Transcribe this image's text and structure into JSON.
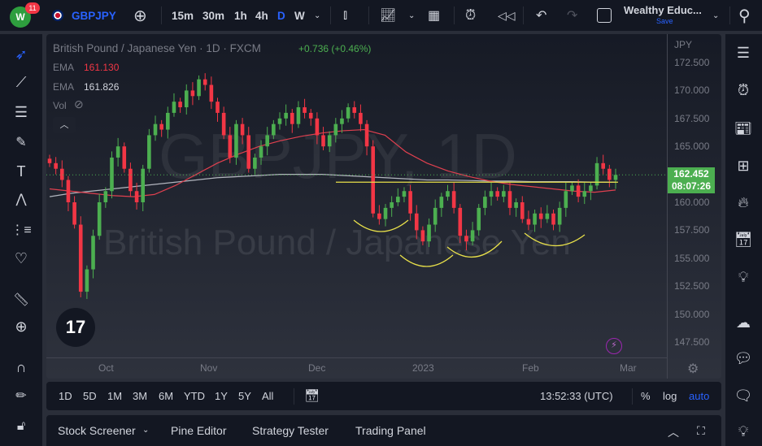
{
  "topbar": {
    "badge": "11",
    "symbol": "GBPJPY",
    "intervals": [
      "15m",
      "30m",
      "1h",
      "4h",
      "D",
      "W"
    ],
    "active_interval": "D",
    "layout_name": "Wealthy Educ...",
    "save_label": "Save"
  },
  "legend": {
    "title": "British Pound / Japanese Yen · 1D · FXCM",
    "change": "+0.736 (+0.46%)",
    "ema1_label": "EMA",
    "ema1_value": "161.130",
    "ema2_label": "EMA",
    "ema2_value": "161.826",
    "vol_label": "Vol"
  },
  "watermark": {
    "line1": "GBPJPY, 1D",
    "line2": "British Pound / Japanese Yen"
  },
  "price_scale": {
    "currency": "JPY",
    "ticks": [
      "172.500",
      "170.000",
      "167.500",
      "165.000",
      "160.000",
      "157.500",
      "155.000",
      "152.500",
      "150.000",
      "147.500"
    ],
    "last_price": "162.452",
    "countdown": "08:07:26"
  },
  "time_axis": [
    "Oct",
    "Nov",
    "Dec",
    "2023",
    "Feb",
    "Mar"
  ],
  "colors": {
    "up": "#4caf50",
    "down": "#f23645",
    "ema_fast": "#e0404f",
    "ema_slow": "#b2b5be",
    "annotation": "#e8e04a",
    "accent": "#2962ff",
    "last": "#4caf50"
  },
  "chart_data": {
    "type": "candlestick",
    "ylim": [
      146.5,
      173.5
    ],
    "closes": [
      163.5,
      163,
      162,
      160,
      158,
      152,
      154,
      157,
      160,
      161,
      164,
      165,
      163,
      161,
      160,
      163,
      166,
      167,
      166.5,
      168,
      169,
      168.5,
      170,
      169.5,
      171,
      170.5,
      169,
      168,
      166,
      164,
      167,
      166,
      163,
      164,
      165,
      166,
      167,
      167.5,
      168,
      167,
      168.5,
      168,
      167.5,
      166,
      165,
      166,
      167,
      167.5,
      168.5,
      168,
      167,
      165,
      159,
      158.5,
      159.5,
      160,
      160.5,
      161,
      159,
      157.5,
      156.5,
      158,
      159.5,
      160.5,
      161,
      159.5,
      157,
      156.5,
      157.5,
      159.5,
      160.5,
      161,
      160.5,
      161,
      159.5,
      160,
      158.5,
      158,
      159,
      158.5,
      159,
      158,
      159.5,
      161,
      161.5,
      160.5,
      161,
      161.5,
      163.5,
      163,
      162,
      162.45
    ],
    "ema_fast": [
      161.2,
      161,
      160.8,
      160.6,
      160.5,
      160.7,
      161.5,
      162.5,
      163.5,
      164.3,
      165,
      165.5,
      165.9,
      166.2,
      166.4,
      166.5,
      166,
      164.5,
      163.5,
      162.8,
      162.3,
      161.9,
      161.6,
      161.4,
      161.2,
      161,
      160.9,
      161.1
    ],
    "ema_slow": [
      160.5,
      160.8,
      161,
      161.2,
      161.4,
      161.6,
      161.8,
      162,
      162.2,
      162.3,
      162.4,
      162.5,
      162.5,
      162.5,
      162.4,
      162.3,
      162.2,
      162.1,
      162,
      162,
      161.95,
      161.9,
      161.9,
      161.85,
      161.85,
      161.85,
      161.8,
      161.8
    ],
    "resistance": 161.8
  },
  "range_bar": {
    "ranges": [
      "1D",
      "5D",
      "1M",
      "3M",
      "6M",
      "YTD",
      "1Y",
      "5Y",
      "All"
    ],
    "time": "13:52:33 (UTC)",
    "percent": "%",
    "log": "log",
    "auto": "auto"
  },
  "bottom_panel": {
    "tabs": [
      "Stock Screener",
      "Pine Editor",
      "Strategy Tester",
      "Trading Panel"
    ]
  }
}
